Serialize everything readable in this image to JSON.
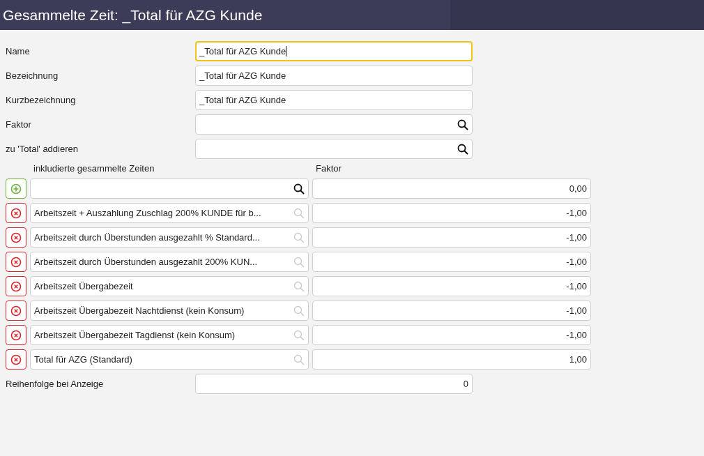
{
  "window": {
    "title": "Gesammelte Zeit: _Total für AZG Kunde"
  },
  "fields": [
    {
      "label": "Name",
      "kind": "text",
      "value": "_Total für AZG Kunde",
      "focused": true
    },
    {
      "label": "Bezeichnung",
      "kind": "text",
      "value": "_Total für AZG Kunde",
      "focused": false
    },
    {
      "label": "Kurzbezeichnung",
      "kind": "text",
      "value": "_Total für AZG Kunde",
      "focused": false
    },
    {
      "label": "Faktor",
      "kind": "lookup",
      "focused": false
    },
    {
      "label": "zu 'Total' addieren",
      "kind": "lookup",
      "focused": false
    }
  ],
  "included": {
    "columns": [
      "inkludierte gesammelte Zeiten",
      "Faktor"
    ],
    "rows": [
      {
        "kind": "add",
        "factor": "0,00"
      },
      {
        "kind": "remove",
        "name": "Arbeitszeit + Auszahlung Zuschlag 200% KUNDE für b...",
        "factor": "-1,00"
      },
      {
        "kind": "remove",
        "name": "Arbeitszeit durch Überstunden ausgezahlt % Standard...",
        "factor": "-1,00"
      },
      {
        "kind": "remove",
        "name": "Arbeitszeit durch Überstunden ausgezahlt 200% KUN...",
        "factor": "-1,00"
      },
      {
        "kind": "remove",
        "name": "Arbeitszeit Übergabezeit",
        "factor": "-1,00"
      },
      {
        "kind": "remove",
        "name": "Arbeitszeit Übergabezeit Nachtdienst (kein Konsum)",
        "factor": "-1,00"
      },
      {
        "kind": "remove",
        "name": "Arbeitszeit Übergabezeit Tagdienst (kein Konsum)",
        "factor": "-1,00"
      },
      {
        "kind": "remove",
        "name": "Total für AZG (Standard)",
        "factor": "1,00"
      }
    ]
  },
  "order": {
    "label": "Reihenfolge bei Anzeige",
    "value": "0"
  }
}
